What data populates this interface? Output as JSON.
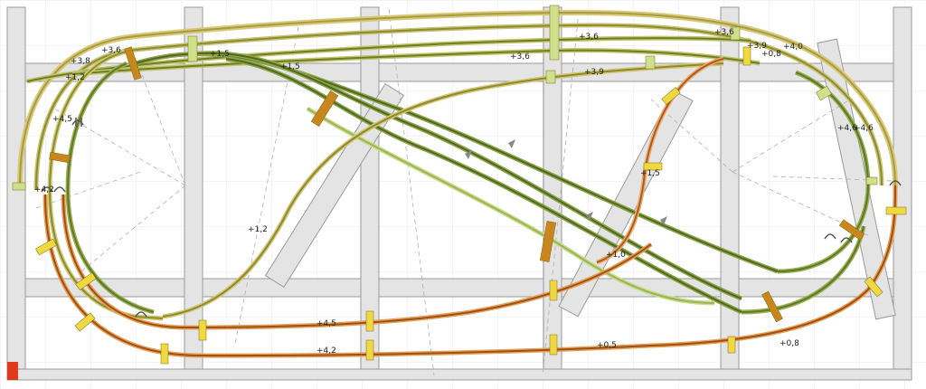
{
  "plan": {
    "colors": {
      "background": "#ffffff",
      "benchwork": "#e4e4e4",
      "benchwork_edge": "#9a9a9a",
      "grid": "#d2d2d2",
      "track_green": "#5e7a22",
      "track_olive": "#8a8f2a",
      "track_yellow": "#c8b23a",
      "track_light": "#b8cf6a",
      "track_orange": "#b85a14",
      "ties": "#d9c977",
      "marker_orange": "#c8861c",
      "marker_yellow": "#f0d840",
      "marker_lightgreen": "#cfe08a",
      "origin": "#e03a1e"
    },
    "height_labels": {
      "inner_top_1": "+3,6",
      "inner_top_2": "+3,6",
      "upper_mid_1": "+3,6",
      "upper_mid_2": "+3,9",
      "right_top_1": "+3,6",
      "right_top_2": "+3,9",
      "right_top_3": "+4,0",
      "right_top_4": "+0,8",
      "left_top_1": "+3,8",
      "left_top_2": "+1,2",
      "left_mid_1": "+1,5",
      "left_mid_2": "+1,5",
      "left_side_1": "+4,5",
      "left_side_2": "+4,2",
      "center_1": "+1,2",
      "center_right_1": "+1,5",
      "center_right_2": "+1,0",
      "right_side_1": "+4,6",
      "right_side_2": "+4,6",
      "bottom_1": "+4,5",
      "bottom_2": "+4,2",
      "bottom_3": "+0,5",
      "bottom_4": "+0,8"
    }
  }
}
